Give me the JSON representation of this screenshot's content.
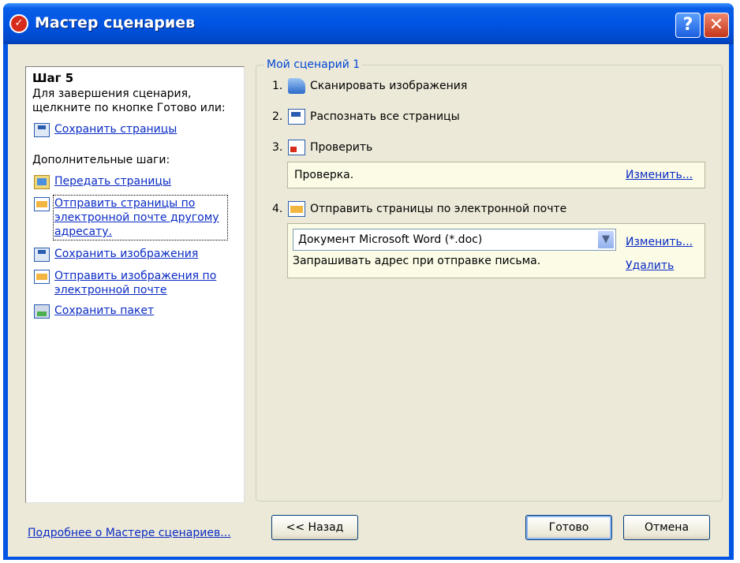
{
  "window": {
    "title": "Мастер сценариев",
    "help_label": "?",
    "close_label": "✕"
  },
  "left_panel": {
    "step_title": "Шаг 5",
    "step_desc": "Для завершения сценария, щелкните по кнопке Готово или:",
    "save_pages": "Сохранить страницы",
    "more_steps_label": "Дополнительные шаги:",
    "links": [
      {
        "label": "Передать страницы",
        "icon": "send-pages-icon"
      },
      {
        "label": "Отправить страницы по электронной почте другому адресату.",
        "icon": "email-pages-icon"
      },
      {
        "label": "Сохранить изображения",
        "icon": "save-images-icon"
      },
      {
        "label": "Отправить изображения по электронной почте",
        "icon": "email-images-icon"
      },
      {
        "label": "Сохранить пакет",
        "icon": "save-package-icon"
      }
    ]
  },
  "bottom_link": "Подробнее о Мастере сценариев...",
  "scenario": {
    "title": "Мой сценарий 1",
    "steps": [
      {
        "num": "1.",
        "label": "Сканировать изображения",
        "icon": "scan-icon"
      },
      {
        "num": "2.",
        "label": "Распознать все страницы",
        "icon": "recognize-icon"
      },
      {
        "num": "3.",
        "label": "Проверить",
        "icon": "verify-icon"
      },
      {
        "num": "4.",
        "label": "Отправить страницы по электронной почте",
        "icon": "email-icon"
      }
    ],
    "verify_box": {
      "label": "Проверка.",
      "change": "Изменить..."
    },
    "email_box": {
      "format_value": "Документ Microsoft Word (*.doc)",
      "change": "Изменить...",
      "ask": "Запрашивать адрес при отправке письма.",
      "delete": "Удалить"
    }
  },
  "buttons": {
    "back": "<< Назад",
    "done": "Готово",
    "cancel": "Отмена"
  },
  "colors": {
    "titlebar": "#0054e3",
    "dialog_bg": "#ece9d8",
    "link": "#0a2bc4",
    "group_title": "#0046d5"
  }
}
